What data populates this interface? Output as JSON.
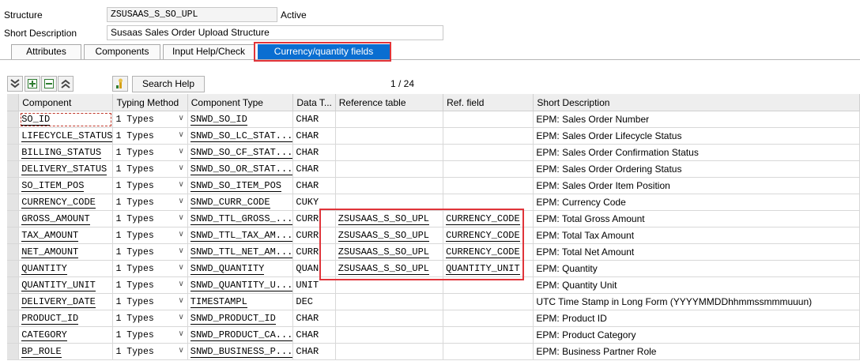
{
  "header": {
    "structure_label": "Structure",
    "structure_value": "ZSUSAAS_S_SO_UPL",
    "status": "Active",
    "short_desc_label": "Short Description",
    "short_desc_value": "Susaas Sales Order Upload Structure"
  },
  "tabs": [
    "Attributes",
    "Components",
    "Input Help/Check",
    "Currency/quantity fields"
  ],
  "active_tab": "Currency/quantity fields",
  "toolbar": {
    "icons": [
      "expand-all-icon",
      "insert-row-icon",
      "delete-row-icon",
      "collapse-all-icon",
      "search-help-icon"
    ],
    "search_help_label": "Search Help",
    "pager": "1 / 24"
  },
  "table": {
    "columns": [
      "Component",
      "Typing Method",
      "Component Type",
      "Data T...",
      "Reference table",
      "Ref. field",
      "Short Description"
    ],
    "rows": [
      {
        "component": "SO_ID",
        "typing": "1 Types",
        "ctype": "SNWD_SO_ID",
        "dtype": "CHAR",
        "rtab": "",
        "rfld": "",
        "desc": "EPM: Sales Order Number"
      },
      {
        "component": "LIFECYCLE_STATUS",
        "typing": "1 Types",
        "ctype": "SNWD_SO_LC_STAT...",
        "dtype": "CHAR",
        "rtab": "",
        "rfld": "",
        "desc": "EPM: Sales Order Lifecycle Status"
      },
      {
        "component": "BILLING_STATUS",
        "typing": "1 Types",
        "ctype": "SNWD_SO_CF_STAT...",
        "dtype": "CHAR",
        "rtab": "",
        "rfld": "",
        "desc": "EPM: Sales Order Confirmation Status"
      },
      {
        "component": "DELIVERY_STATUS",
        "typing": "1 Types",
        "ctype": "SNWD_SO_OR_STAT...",
        "dtype": "CHAR",
        "rtab": "",
        "rfld": "",
        "desc": "EPM: Sales Order Ordering Status"
      },
      {
        "component": "SO_ITEM_POS",
        "typing": "1 Types",
        "ctype": "SNWD_SO_ITEM_POS",
        "dtype": "CHAR",
        "rtab": "",
        "rfld": "",
        "desc": "EPM: Sales Order Item Position"
      },
      {
        "component": "CURRENCY_CODE",
        "typing": "1 Types",
        "ctype": "SNWD_CURR_CODE",
        "dtype": "CUKY",
        "rtab": "",
        "rfld": "",
        "desc": "EPM: Currency Code"
      },
      {
        "component": "GROSS_AMOUNT",
        "typing": "1 Types",
        "ctype": "SNWD_TTL_GROSS_...",
        "dtype": "CURR",
        "rtab": "ZSUSAAS_S_SO_UPL",
        "rfld": "CURRENCY_CODE",
        "desc": "EPM: Total Gross Amount"
      },
      {
        "component": "TAX_AMOUNT",
        "typing": "1 Types",
        "ctype": "SNWD_TTL_TAX_AM...",
        "dtype": "CURR",
        "rtab": "ZSUSAAS_S_SO_UPL",
        "rfld": "CURRENCY_CODE",
        "desc": "EPM: Total Tax Amount"
      },
      {
        "component": "NET_AMOUNT",
        "typing": "1 Types",
        "ctype": "SNWD_TTL_NET_AM...",
        "dtype": "CURR",
        "rtab": "ZSUSAAS_S_SO_UPL",
        "rfld": "CURRENCY_CODE",
        "desc": "EPM: Total Net Amount"
      },
      {
        "component": "QUANTITY",
        "typing": "1 Types",
        "ctype": "SNWD_QUANTITY",
        "dtype": "QUAN",
        "rtab": "ZSUSAAS_S_SO_UPL",
        "rfld": "QUANTITY_UNIT",
        "desc": "EPM: Quantity"
      },
      {
        "component": "QUANTITY_UNIT",
        "typing": "1 Types",
        "ctype": "SNWD_QUANTITY_U...",
        "dtype": "UNIT",
        "rtab": "",
        "rfld": "",
        "desc": "EPM: Quantity Unit"
      },
      {
        "component": "DELIVERY_DATE",
        "typing": "1 Types",
        "ctype": "TIMESTAMPL",
        "dtype": "DEC",
        "rtab": "",
        "rfld": "",
        "desc": "UTC Time Stamp in Long Form (YYYYMMDDhhmmssmmmuuun)"
      },
      {
        "component": "PRODUCT_ID",
        "typing": "1 Types",
        "ctype": "SNWD_PRODUCT_ID",
        "dtype": "CHAR",
        "rtab": "",
        "rfld": "",
        "desc": "EPM: Product ID"
      },
      {
        "component": "CATEGORY",
        "typing": "1 Types",
        "ctype": "SNWD_PRODUCT_CA...",
        "dtype": "CHAR",
        "rtab": "",
        "rfld": "",
        "desc": "EPM: Product Category"
      },
      {
        "component": "BP_ROLE",
        "typing": "1 Types",
        "ctype": "SNWD_BUSINESS_P...",
        "dtype": "CHAR",
        "rtab": "",
        "rfld": "",
        "desc": "EPM: Business Partner Role"
      }
    ]
  },
  "colors": {
    "active_tab": "#0a6ed1",
    "highlight_border": "#e0343a",
    "selector_column": "#e4e4e4"
  }
}
